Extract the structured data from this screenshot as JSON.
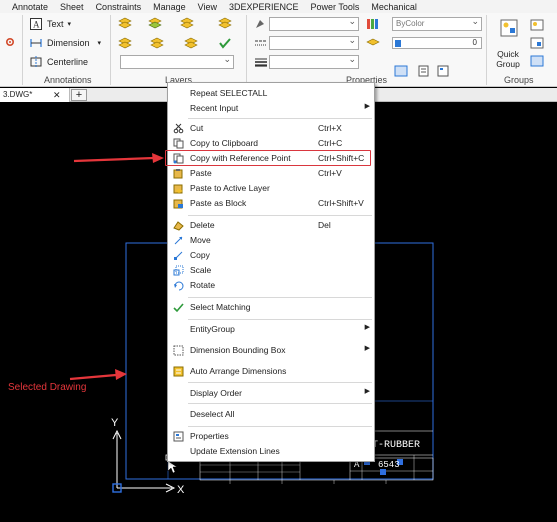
{
  "menubar": {
    "items": [
      "Annotate",
      "Sheet",
      "Constraints",
      "Manage",
      "View",
      "3DEXPERIENCE",
      "Power Tools",
      "Mechanical"
    ]
  },
  "ribbon": {
    "annotations": {
      "text_label": "Text",
      "dimension_label": "Dimension",
      "centerline_label": "Centerline",
      "panel_label": "Annotations"
    },
    "layers": {
      "panel_label": "Layers"
    },
    "properties": {
      "color_value": "ByColor",
      "transparency_value": "0",
      "panel_label": "Properties"
    },
    "groups": {
      "quick_group_label": "Quick Group",
      "panel_label": "Groups"
    },
    "accent_color": "#2b78d6"
  },
  "tabs": {
    "document": "3.DWG*",
    "close_glyph": "✕",
    "new_tab_glyph": "+"
  },
  "context_menu": {
    "items": [
      {
        "label": "Repeat SELECTALL",
        "shortcut": "",
        "submenu": false,
        "icon": ""
      },
      {
        "label": "Recent Input",
        "shortcut": "",
        "submenu": true,
        "icon": ""
      },
      {
        "label": "Cut",
        "shortcut": "Ctrl+X",
        "submenu": false,
        "icon": "scissors-icon"
      },
      {
        "label": "Copy to Clipboard",
        "shortcut": "Ctrl+C",
        "submenu": false,
        "icon": "copy-icon"
      },
      {
        "label": "Copy with Reference Point",
        "shortcut": "Ctrl+Shift+C",
        "submenu": false,
        "icon": "copy-base-icon"
      },
      {
        "label": "Paste",
        "shortcut": "Ctrl+V",
        "submenu": false,
        "icon": "paste-icon"
      },
      {
        "label": "Paste to Active Layer",
        "shortcut": "",
        "submenu": false,
        "icon": "paste-layer-icon"
      },
      {
        "label": "Paste as Block",
        "shortcut": "Ctrl+Shift+V",
        "submenu": false,
        "icon": "paste-block-icon"
      },
      {
        "label": "Delete",
        "shortcut": "Del",
        "submenu": false,
        "icon": "eraser-icon"
      },
      {
        "label": "Move",
        "shortcut": "",
        "submenu": false,
        "icon": "move-icon"
      },
      {
        "label": "Copy",
        "shortcut": "",
        "submenu": false,
        "icon": "copy-entity-icon"
      },
      {
        "label": "Scale",
        "shortcut": "",
        "submenu": false,
        "icon": "scale-icon"
      },
      {
        "label": "Rotate",
        "shortcut": "",
        "submenu": false,
        "icon": "rotate-icon"
      },
      {
        "label": "Select Matching",
        "shortcut": "",
        "submenu": false,
        "icon": "select-matching-icon"
      },
      {
        "label": "EntityGroup",
        "shortcut": "",
        "submenu": true,
        "icon": ""
      },
      {
        "label": "Dimension Bounding Box",
        "shortcut": "",
        "submenu": true,
        "icon": "bounding-box-icon"
      },
      {
        "label": "Auto Arrange Dimensions",
        "shortcut": "",
        "submenu": false,
        "icon": "auto-arrange-icon"
      },
      {
        "label": "Display Order",
        "shortcut": "",
        "submenu": true,
        "icon": ""
      },
      {
        "label": "Deselect All",
        "shortcut": "",
        "submenu": false,
        "icon": ""
      },
      {
        "label": "Properties",
        "shortcut": "",
        "submenu": false,
        "icon": "properties-icon"
      },
      {
        "label": "Update Extension Lines",
        "shortcut": "",
        "submenu": false,
        "icon": ""
      }
    ],
    "submenu_arrow": "▶",
    "highlight_color": "#d9363e"
  },
  "drawing": {
    "title_text": "T-RUBBER",
    "size_label": "A",
    "number_text": "6543",
    "line_color": "#2f6fe0",
    "axis_x": "X",
    "axis_y": "Y"
  },
  "annotation": {
    "selected_label": "Selected Drawing",
    "color": "#e5363b"
  }
}
